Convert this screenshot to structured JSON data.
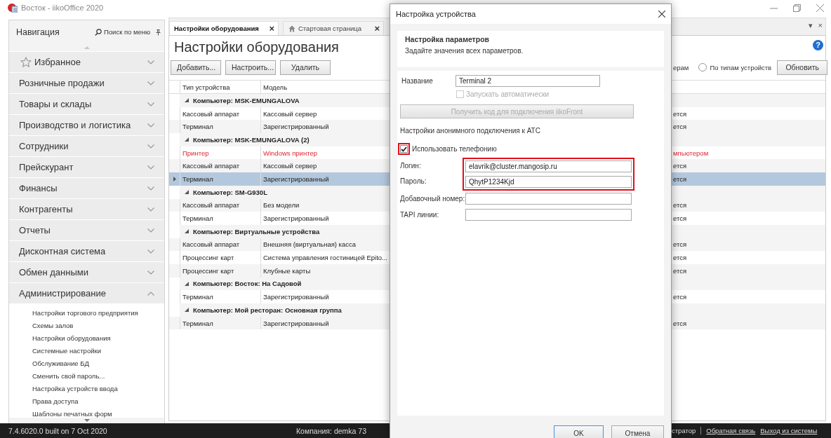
{
  "window": {
    "title": "Восток - iikoOffice 2020"
  },
  "nav": {
    "title": "Навигация",
    "search": "Поиск по меню",
    "groups": [
      {
        "label": "Избранное",
        "kind": "favorites",
        "expanded": false
      },
      {
        "label": "Розничные продажи",
        "kind": "plain",
        "expanded": false
      },
      {
        "label": "Товары и склады",
        "kind": "plain",
        "expanded": false
      },
      {
        "label": "Производство и логистика",
        "kind": "plain",
        "expanded": false
      },
      {
        "label": "Сотрудники",
        "kind": "plain",
        "expanded": false
      },
      {
        "label": "Прейскурант",
        "kind": "plain",
        "expanded": false
      },
      {
        "label": "Финансы",
        "kind": "plain",
        "expanded": false
      },
      {
        "label": "Контрагенты",
        "kind": "plain",
        "expanded": false
      },
      {
        "label": "Отчеты",
        "kind": "plain",
        "expanded": false
      },
      {
        "label": "Дисконтная система",
        "kind": "plain",
        "expanded": false
      },
      {
        "label": "Обмен данными",
        "kind": "plain",
        "expanded": false
      },
      {
        "label": "Администрирование",
        "kind": "plain",
        "expanded": true,
        "items": [
          "Настройки торгового предприятия",
          "Схемы залов",
          "Настройки оборудования",
          "Системные настройки",
          "Обслуживание БД",
          "Сменить свой пароль...",
          "Настройка устройств ввода",
          "Права доступа",
          "Шаблоны печатных форм"
        ]
      }
    ]
  },
  "tabs": [
    {
      "label": "Настройки оборудования",
      "kind": "page",
      "selected": true,
      "close": "×"
    },
    {
      "label": "Стартовая страница",
      "kind": "home",
      "selected": false,
      "close": "×"
    }
  ],
  "tab_strip": {
    "menu": "▾",
    "close": "×"
  },
  "page": {
    "title": "Настройки оборудования",
    "help": "?",
    "buttons": [
      "Добавить...",
      "Настроить...",
      "Удалить"
    ],
    "partial_label": "ерам",
    "radio": {
      "label": "По типам устройств",
      "selected": false
    },
    "refresh": "Обновить"
  },
  "table": {
    "columns": [
      "Тип устройства",
      "Модель"
    ],
    "groups": [
      {
        "title": "Компьютер: MSK-EMUNGALOVA",
        "expanded": true,
        "rows": [
          {
            "type": "Кассовый аппарат",
            "model": "Кассовый сервер",
            "column_3": "ется",
            "selected": false,
            "error": false
          },
          {
            "type": "Терминал",
            "model": "Зарегистрированный",
            "column_3": "ется",
            "selected": false,
            "error": false
          }
        ]
      },
      {
        "title": "Компьютер: MSK-EMUNGALOVA (2)",
        "expanded": true,
        "rows": [
          {
            "type": "Принтер",
            "model": "Windows принтер",
            "column_3": "мпьютером",
            "selected": false,
            "error": true
          },
          {
            "type": "Кассовый аппарат",
            "model": "Кассовый сервер",
            "column_3": "ется",
            "selected": false,
            "error": false
          },
          {
            "type": "Терминал",
            "model": "Зарегистрированный",
            "column_3": "ется",
            "selected": true,
            "error": false
          }
        ]
      },
      {
        "title": "Компьютер: SM-G930L",
        "expanded": true,
        "rows": [
          {
            "type": "Кассовый аппарат",
            "model": "Без модели",
            "column_3": "ется",
            "selected": false,
            "error": false
          },
          {
            "type": "Терминал",
            "model": "Зарегистрированный",
            "column_3": "ется",
            "selected": false,
            "error": false
          }
        ]
      },
      {
        "title": "Компьютер: Виртуальные устройства",
        "expanded": true,
        "rows": [
          {
            "type": "Кассовый аппарат",
            "model": "Внешняя (виртуальная) касса",
            "column_3": "ется",
            "selected": false,
            "error": false
          },
          {
            "type": "Процессинг карт",
            "model": "Система управления гостиницей Epito...",
            "column_3": "ется",
            "selected": false,
            "error": false
          },
          {
            "type": "Процессинг карт",
            "model": "Клубные карты",
            "column_3": "ется",
            "selected": false,
            "error": false
          }
        ]
      },
      {
        "title": "Компьютер: Восток: На Садовой",
        "expanded": true,
        "rows": [
          {
            "type": "Терминал",
            "model": "Зарегистрированный",
            "column_3": "ется",
            "selected": false,
            "error": false
          }
        ]
      },
      {
        "title": "Компьютер: Мой ресторан: Основная группа",
        "expanded": true,
        "rows": [
          {
            "type": "Терминал",
            "model": "Зарегистрированный",
            "column_3": "ется",
            "selected": false,
            "error": false
          }
        ]
      }
    ]
  },
  "status_bar": {
    "version": "7.4.6020.0 built on 7 Oct 2020",
    "company": "Компания: demka 73",
    "user": "стратор",
    "links": [
      "Обратная связь",
      "Выход из системы"
    ]
  },
  "dialog": {
    "title": "Настройка устройства",
    "header_title": "Настройка параметров",
    "header_text": "Задайте значения всех параметров.",
    "name": {
      "label": "Название",
      "value": "Terminal 2"
    },
    "autostart": {
      "label": "Запускать автоматически",
      "checked": false,
      "disabled": true
    },
    "code_button": {
      "label": "Получить код для подключения iikoFront",
      "disabled": true
    },
    "section": "Настройки анонимного подключения к АТС",
    "telephony": {
      "label": "Использовать телефонию",
      "checked": true,
      "highlighted": true
    },
    "credentials": {
      "highlighted": true,
      "fields": [
        {
          "label": "Логин:",
          "value": "elavrik@cluster.mangosip.ru"
        },
        {
          "label": "Пароль:",
          "value": "QhytP1234Kjd"
        }
      ]
    },
    "extra_fields": [
      {
        "label": "Добавочный номер:"
      },
      {
        "label": "TAPI линии:"
      }
    ],
    "buttons": [
      {
        "label": "OK",
        "default": true
      },
      {
        "label": "Отмена",
        "default": false
      }
    ]
  }
}
